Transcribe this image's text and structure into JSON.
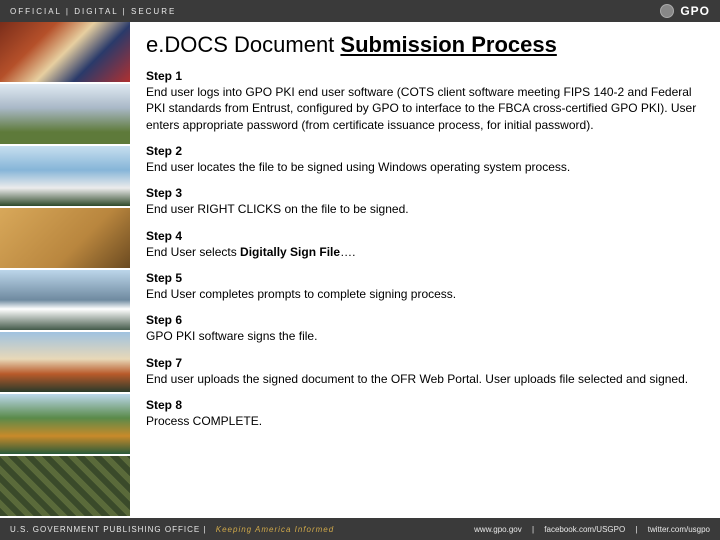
{
  "topbar": {
    "left": "OFFICIAL | DIGITAL | SECURE",
    "logo": "GPO"
  },
  "title": {
    "prefix": "e.DOCS Document ",
    "underlined": "Submission Process"
  },
  "steps": [
    {
      "label": "Step 1",
      "body": "End user logs into GPO PKI end user software (COTS client software meeting FIPS 140-2 and Federal PKI standards from Entrust, configured by GPO to interface to the FBCA cross-certified GPO PKI). User enters appropriate password (from certificate issuance process, for initial password)."
    },
    {
      "label": "Step 2",
      "body": "End user locates the file to be signed using Windows operating system process."
    },
    {
      "label": "Step 3",
      "body": "End user RIGHT CLICKS on the file to be signed."
    },
    {
      "label": "Step 4",
      "body_pre": "End User selects ",
      "body_bold": "Digitally Sign File",
      "body_post": "…."
    },
    {
      "label": "Step 5",
      "body": "End User completes prompts to complete signing process."
    },
    {
      "label": "Step 6",
      "body": "GPO PKI software signs the file."
    },
    {
      "label": "Step 7",
      "body": "End user uploads the signed document to the OFR Web Portal. User uploads file selected and signed."
    },
    {
      "label": "Step 8",
      "body": "Process COMPLETE."
    }
  ],
  "footer": {
    "org": "U.S. GOVERNMENT PUBLISHING OFFICE",
    "tagline": "Keeping America Informed",
    "links": {
      "site": "www.gpo.gov",
      "fb": "facebook.com/USGPO",
      "tw": "twitter.com/usgpo"
    }
  }
}
